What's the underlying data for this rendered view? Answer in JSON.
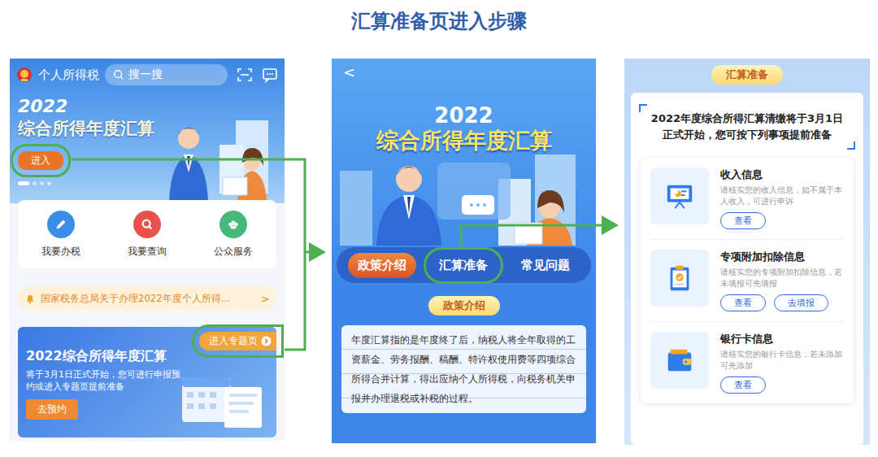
{
  "title": "汇算准备页进入步骤",
  "home": {
    "app_name": "个人所得税",
    "search": {
      "placeholder": "搜一搜"
    },
    "banner": {
      "year": "2022",
      "title": "综合所得年度汇算",
      "button": {
        "label": "进入",
        "highlighted": true
      },
      "dots": [
        {
          "selected": true
        },
        {
          "selected": false
        },
        {
          "selected": false
        },
        {
          "selected": false
        }
      ]
    },
    "actions": [
      {
        "label": "我要办税",
        "color": "#3b8ee8"
      },
      {
        "label": "我要查询",
        "color": "#e8524a"
      },
      {
        "label": "公众服务",
        "color": "#45b87a"
      }
    ],
    "notice": {
      "text": "国家税务总局关于办理2022年度个人所得…",
      "arrow": ">"
    },
    "promo": {
      "title": "2022综合所得年度汇算",
      "desc": "将于3月1日正式开始，您可进行申报预约或进入专题页提前准备",
      "link": {
        "label": "进入专题页",
        "highlighted": true
      },
      "button": "去预约"
    }
  },
  "topic": {
    "back": "<",
    "year": "2022",
    "title": "综合所得年度汇算",
    "tabs": [
      {
        "label": "政策介绍",
        "selected": true,
        "highlighted": false
      },
      {
        "label": "汇算准备",
        "selected": false,
        "highlighted": true
      },
      {
        "label": "常见问题",
        "selected": false,
        "highlighted": false
      }
    ],
    "section": "政策介绍",
    "body": "年度汇算指的是年度终了后，纳税人将全年取得的工资薪金、劳务报酬、稿酬、特许权使用费等四项综合所得合并计算，得出应纳个人所得税，向税务机关申报并办理退税或补税的过程。"
  },
  "prepare": {
    "heading": "汇算准备",
    "notice": "2022年度综合所得汇算清缴将于3月1日正式开始，您可按下列事项提前准备",
    "items": [
      {
        "title": "收入信息",
        "desc": "请核实您的收入信息，如不属于本人收入，可进行申诉",
        "buttons": [
          "查看"
        ]
      },
      {
        "title": "专项附加扣除信息",
        "desc": "请核实您的专项附加扣除信息，若未填报可先填报",
        "buttons": [
          "查看",
          "去填报"
        ]
      },
      {
        "title": "银行卡信息",
        "desc": "请核实您的银行卡信息，若未添加可先添加",
        "buttons": [
          "查看"
        ]
      }
    ]
  }
}
